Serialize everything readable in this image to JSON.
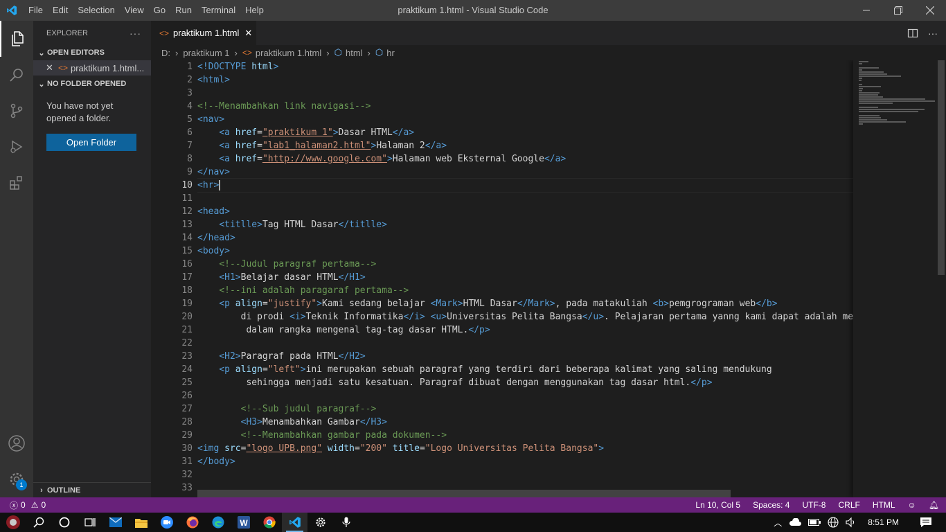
{
  "app": {
    "window_title": "praktikum 1.html - Visual Studio Code",
    "menu": [
      "File",
      "Edit",
      "Selection",
      "View",
      "Go",
      "Run",
      "Terminal",
      "Help"
    ],
    "accent_color": "#68217a"
  },
  "sidebar": {
    "title": "EXPLORER",
    "more": "···",
    "open_editors_label": "OPEN EDITORS",
    "open_editor_file": "praktikum 1.html...",
    "no_folder_label": "NO FOLDER OPENED",
    "message": "You have not yet opened a folder.",
    "open_folder_button": "Open Folder",
    "outline_label": "OUTLINE"
  },
  "activity": {
    "settings_badge": "1"
  },
  "tabs": [
    {
      "label": "praktikum 1.html",
      "active": true
    }
  ],
  "breadcrumb": [
    "D:",
    "praktikum 1",
    "praktikum 1.html",
    "html",
    "hr"
  ],
  "editor": {
    "current_line": 10,
    "line_numbers": [
      "1",
      "2",
      "3",
      "4",
      "5",
      "6",
      "7",
      "8",
      "9",
      "10",
      "11",
      "12",
      "13",
      "14",
      "15",
      "16",
      "17",
      "18",
      "19",
      "20",
      "21",
      "22",
      "23",
      "24",
      "25",
      "26",
      "27",
      "28",
      "29",
      "30",
      "31",
      "32",
      "33"
    ],
    "lines": [
      [
        [
          "t",
          "<!DOCTYPE "
        ],
        [
          "at",
          "html"
        ],
        [
          "t",
          ">"
        ]
      ],
      [
        [
          "t",
          "<html>"
        ]
      ],
      [],
      [
        [
          "c",
          "<!--Menambahkan link navigasi-->"
        ]
      ],
      [
        [
          "t",
          "<nav>"
        ]
      ],
      [
        [
          "x",
          "    "
        ],
        [
          "t",
          "<a "
        ],
        [
          "at",
          "href"
        ],
        [
          "x",
          "="
        ],
        [
          "s",
          "\"praktikum 1\""
        ],
        [
          "t",
          ">"
        ],
        [
          "x",
          "Dasar HTML"
        ],
        [
          "t",
          "</a>"
        ]
      ],
      [
        [
          "x",
          "    "
        ],
        [
          "t",
          "<a "
        ],
        [
          "at",
          "href"
        ],
        [
          "x",
          "="
        ],
        [
          "s",
          "\"lab1_halaman2.html\""
        ],
        [
          "t",
          ">"
        ],
        [
          "x",
          "Halaman 2"
        ],
        [
          "t",
          "</a>"
        ]
      ],
      [
        [
          "x",
          "    "
        ],
        [
          "t",
          "<a "
        ],
        [
          "at",
          "href"
        ],
        [
          "x",
          "="
        ],
        [
          "s",
          "\"http://www.google.com\""
        ],
        [
          "t",
          ">"
        ],
        [
          "x",
          "Halaman web Eksternal Google"
        ],
        [
          "t",
          "</a>"
        ]
      ],
      [
        [
          "t",
          "</nav>"
        ]
      ],
      [
        [
          "t",
          "<hr>"
        ]
      ],
      [],
      [
        [
          "t",
          "<head>"
        ]
      ],
      [
        [
          "x",
          "    "
        ],
        [
          "t",
          "<titlle>"
        ],
        [
          "x",
          "Tag HTML Dasar"
        ],
        [
          "t",
          "</titlle>"
        ]
      ],
      [
        [
          "t",
          "</head>"
        ]
      ],
      [
        [
          "t",
          "<body>"
        ]
      ],
      [
        [
          "x",
          "    "
        ],
        [
          "c",
          "<!--Judul paragraf pertama-->"
        ]
      ],
      [
        [
          "x",
          "    "
        ],
        [
          "t",
          "<H1>"
        ],
        [
          "x",
          "Belajar dasar HTML"
        ],
        [
          "t",
          "</H1>"
        ]
      ],
      [
        [
          "x",
          "    "
        ],
        [
          "c",
          "<!--ini adalah paragaraf pertama-->"
        ]
      ],
      [
        [
          "x",
          "    "
        ],
        [
          "t",
          "<p "
        ],
        [
          "at",
          "align"
        ],
        [
          "x",
          "="
        ],
        [
          "s2",
          "\"justify\""
        ],
        [
          "t",
          ">"
        ],
        [
          "x",
          "Kami sedang belajar "
        ],
        [
          "t",
          "<Mark>"
        ],
        [
          "x",
          "HTML Dasar"
        ],
        [
          "t",
          "</Mark>"
        ],
        [
          "x",
          ", pada matakuliah "
        ],
        [
          "t",
          "<b>"
        ],
        [
          "x",
          "pemgrograman web"
        ],
        [
          "t",
          "</b>"
        ]
      ],
      [
        [
          "x",
          "        di prodi "
        ],
        [
          "t",
          "<i>"
        ],
        [
          "x",
          "Teknik Informatika"
        ],
        [
          "t",
          "</i>"
        ],
        [
          "x",
          " "
        ],
        [
          "t",
          "<u>"
        ],
        [
          "x",
          "Universitas Pelita Bangsa"
        ],
        [
          "t",
          "</u>"
        ],
        [
          "x",
          ". Pelajaran pertama yanng kami dapat adalah memb"
        ]
      ],
      [
        [
          "x",
          "         dalam rangka mengenal tag-tag dasar HTML."
        ],
        [
          "t",
          "</p>"
        ]
      ],
      [],
      [
        [
          "x",
          "    "
        ],
        [
          "t",
          "<H2>"
        ],
        [
          "x",
          "Paragraf pada HTML"
        ],
        [
          "t",
          "</H2>"
        ]
      ],
      [
        [
          "x",
          "    "
        ],
        [
          "t",
          "<p "
        ],
        [
          "at",
          "align"
        ],
        [
          "x",
          "="
        ],
        [
          "s2",
          "\"left\""
        ],
        [
          "t",
          ">"
        ],
        [
          "x",
          "ini merupakan sebuah paragraf yang terdiri dari beberapa kalimat yang saling mendukung"
        ]
      ],
      [
        [
          "x",
          "         sehingga menjadi satu kesatuan. Paragraf dibuat dengan menggunakan tag dasar html."
        ],
        [
          "t",
          "</p>"
        ]
      ],
      [],
      [
        [
          "x",
          "        "
        ],
        [
          "c",
          "<!--Sub judul paragraf-->"
        ]
      ],
      [
        [
          "x",
          "        "
        ],
        [
          "t",
          "<H3>"
        ],
        [
          "x",
          "Menambahkan Gambar"
        ],
        [
          "t",
          "</H3>"
        ]
      ],
      [
        [
          "x",
          "        "
        ],
        [
          "c",
          "<!--Menambahkan gambar pada dokumen-->"
        ]
      ],
      [
        [
          "t",
          "<img "
        ],
        [
          "at",
          "src"
        ],
        [
          "x",
          "="
        ],
        [
          "s",
          "\"logo UPB.png\""
        ],
        [
          "x",
          " "
        ],
        [
          "at",
          "width"
        ],
        [
          "x",
          "="
        ],
        [
          "s2",
          "\"200\""
        ],
        [
          "x",
          " "
        ],
        [
          "at",
          "title"
        ],
        [
          "x",
          "="
        ],
        [
          "s2",
          "\"Logo Universitas Pelita Bangsa\""
        ],
        [
          "t",
          ">"
        ]
      ],
      [
        [
          "t",
          "</body>"
        ]
      ],
      [],
      []
    ]
  },
  "status": {
    "errors": "0",
    "warnings": "0",
    "position": "Ln 10, Col 5",
    "spaces": "Spaces: 4",
    "encoding": "UTF-8",
    "eol": "CRLF",
    "language": "HTML"
  },
  "taskbar": {
    "time": "8:51 PM"
  }
}
